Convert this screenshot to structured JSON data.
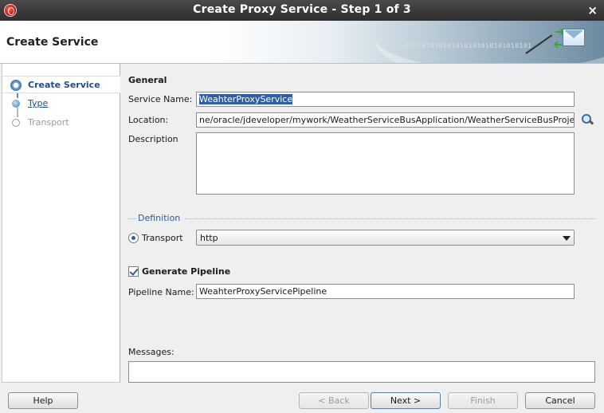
{
  "window": {
    "title": "Create Proxy Service - Step 1 of 3",
    "close_glyph": "×"
  },
  "header": {
    "title": "Create Service",
    "binary_text": "010101010101010101010101010101"
  },
  "steps": [
    {
      "label": "Create Service",
      "state": "current"
    },
    {
      "label": "Type",
      "state": "link"
    },
    {
      "label": "Transport",
      "state": "disabled"
    }
  ],
  "general": {
    "title": "General",
    "service_name_label": "Service Name:",
    "service_name_value": "WeahterProxyService",
    "location_label": "Location:",
    "location_value": "ne/oracle/jdeveloper/mywork/WeatherServiceBusApplication/WeatherServiceBusProject",
    "description_label": "Description",
    "description_value": ""
  },
  "definition": {
    "title": "Definition",
    "transport_label": "Transport",
    "transport_value": "http"
  },
  "pipeline": {
    "generate_label": "Generate Pipeline",
    "generate_checked": true,
    "name_label": "Pipeline Name:",
    "name_value": "WeahterProxyServicePipeline"
  },
  "messages": {
    "label": "Messages:",
    "value": ""
  },
  "buttons": {
    "help": "Help",
    "back": "< Back",
    "next": "Next >",
    "finish": "Finish",
    "cancel": "Cancel"
  },
  "colors": {
    "accent": "#1d4e89",
    "selection": "#2f5ea6"
  },
  "icons": [
    "app-icon",
    "close-icon",
    "service-wizard-icon",
    "search-icon",
    "chevron-down-icon"
  ]
}
